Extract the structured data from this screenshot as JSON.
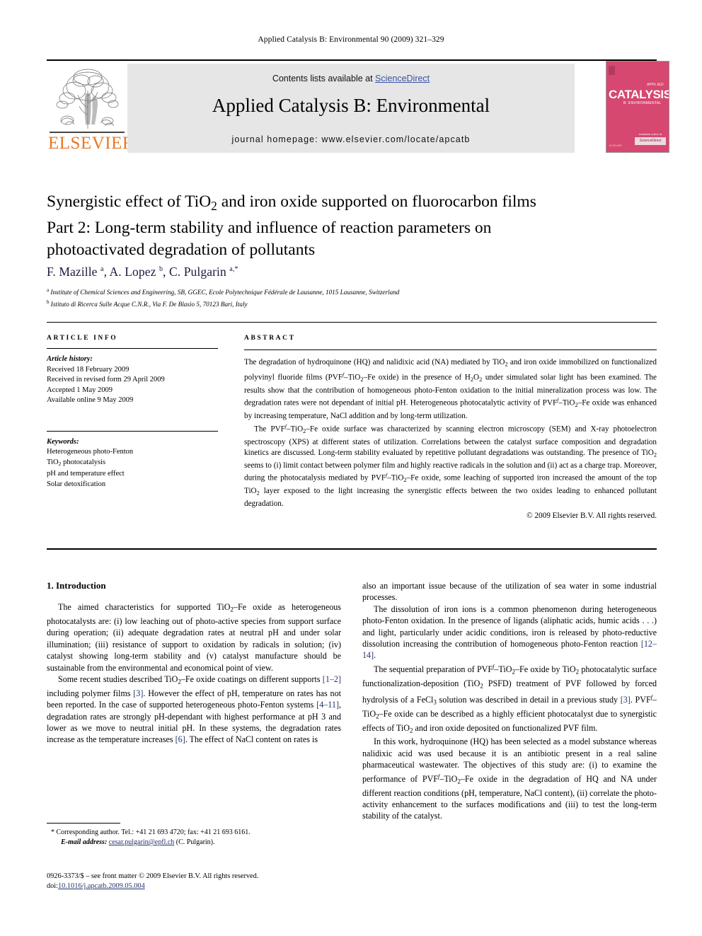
{
  "running_head": "Applied Catalysis B: Environmental 90 (2009) 321–329",
  "masthead": {
    "contents_prefix": "Contents lists available at ",
    "sciencedirect": "ScienceDirect",
    "journal_title": "Applied Catalysis B: Environmental",
    "homepage": "journal homepage: www.elsevier.com/locate/apcatb",
    "publisher": "ELSEVIER",
    "cover": {
      "applied": "APPLIED",
      "catalysis": "CATALYSIS",
      "environmental": "B: ENVIRONMENTAL",
      "sciencedirect_badge": "ScienceDirect",
      "available_online": "Available online at",
      "footline": "ELSEVIER"
    },
    "accent_color": "#E87722",
    "link_color": "#3a53a4",
    "cover_color": "#d6486f"
  },
  "article": {
    "title_line1": "Synergistic effect of TiO2 and iron oxide supported on fluorocarbon films",
    "title_line2": "Part 2: Long-term stability and influence of reaction parameters on",
    "title_line3": "photoactivated degradation of pollutants",
    "authors": "F. Mazille a, A. Lopez b, C. Pulgarin a,*",
    "affiliation_a": "Institute of Chemical Sciences and Engineering, SB, GGEC, Ecole Polytechnique Fédérale de Lausanne, 1015 Lausanne, Switzerland",
    "affiliation_b": "Istituto di Ricerca Sulle Acque C.N.R., Via F. De Blasio 5, 70123 Bari, Italy"
  },
  "article_info": {
    "heading": "ARTICLE INFO",
    "history_label": "Article history:",
    "history": [
      "Received 18 February 2009",
      "Received in revised form 29 April 2009",
      "Accepted 1 May 2009",
      "Available online 9 May 2009"
    ],
    "keywords_label": "Keywords:",
    "keywords": [
      "Heterogeneous photo-Fenton",
      "TiO2 photocatalysis",
      "pH and temperature effect",
      "Solar detoxification"
    ]
  },
  "abstract": {
    "heading": "ABSTRACT",
    "paragraph1": "The degradation of hydroquinone (HQ) and nalidixic acid (NA) mediated by TiO2 and iron oxide immobilized on functionalized polyvinyl fluoride films (PVFf–TiO2–Fe oxide) in the presence of H2O2 under simulated solar light has been examined. The results show that the contribution of homogeneous photo-Fenton oxidation to the initial mineralization process was low. The degradation rates were not dependant of initial pH. Heterogeneous photocatalytic activity of PVFf–TiO2–Fe oxide was enhanced by increasing temperature, NaCl addition and by long-term utilization.",
    "paragraph2": "The PVFf–TiO2–Fe oxide surface was characterized by scanning electron microscopy (SEM) and X-ray photoelectron spectroscopy (XPS) at different states of utilization. Correlations between the catalyst surface composition and degradation kinetics are discussed. Long-term stability evaluated by repetitive pollutant degradations was outstanding. The presence of TiO2 seems to (i) limit contact between polymer film and highly reactive radicals in the solution and (ii) act as a charge trap. Moreover, during the photocatalysis mediated by PVFf–TiO2–Fe oxide, some leaching of supported iron increased the amount of the top TiO2 layer exposed to the light increasing the synergistic effects between the two oxides leading to enhanced pollutant degradation.",
    "copyright": "© 2009 Elsevier B.V. All rights reserved."
  },
  "body": {
    "section1_heading": "1. Introduction",
    "left_p1": "The aimed characteristics for supported TiO2–Fe oxide as heterogeneous photocatalysts are: (i) low leaching out of photo-active species from support surface during operation; (ii) adequate degradation rates at neutral pH and under solar illumination; (iii) resistance of support to oxidation by radicals in solution; (iv) catalyst showing long-term stability and (v) catalyst manufacture should be sustainable from the environmental and economical point of view.",
    "left_p2": "Some recent studies described TiO2–Fe oxide coatings on different supports [1–2] including polymer films [3]. However the effect of pH, temperature on rates has not been reported. In the case of supported heterogeneous photo-Fenton systems [4–11], degradation rates are strongly pH-dependant with highest performance at pH 3 and lower as we move to neutral initial pH. In these systems, the degradation rates increase as the temperature increases [6]. The effect of NaCl content on rates is",
    "right_p1": "also an important issue because of the utilization of sea water in some industrial processes.",
    "right_p2": "The dissolution of iron ions is a common phenomenon during heterogeneous photo-Fenton oxidation. In the presence of ligands (aliphatic acids, humic acids . . .) and light, particularly under acidic conditions, iron is released by photo-reductive dissolution increasing the contribution of homogeneous photo-Fenton reaction [12–14].",
    "right_p3": "The sequential preparation of PVFf–TiO2–Fe oxide by TiO2 photocatalytic surface functionalization-deposition (TiO2 PSFD) treatment of PVF followed by forced hydrolysis of a FeCl3 solution was described in detail in a previous study [3]. PVFf–TiO2–Fe oxide can be described as a highly efficient photocatalyst due to synergistic effects of TiO2 and iron oxide deposited on functionalized PVF film.",
    "right_p4": "In this work, hydroquinone (HQ) has been selected as a model substance whereas nalidixic acid was used because it is an antibiotic present in a real saline pharmaceutical wastewater. The objectives of this study are: (i) to examine the performance of PVFf–TiO2–Fe oxide in the degradation of HQ and NA under different reaction conditions (pH, temperature, NaCl content), (ii) correlate the photo-activity enhancement to the surfaces modifications and (iii) to test the long-term stability of the catalyst."
  },
  "footnotes": {
    "corresponding": "* Corresponding author. Tel.: +41 21 693 4720; fax: +41 21 693 6161.",
    "email_label": "E-mail address:",
    "email": "cesar.pulgarin@epfl.ch",
    "email_suffix": "(C. Pulgarin).",
    "imprint_line1": "0926-3373/$ – see front matter © 2009 Elsevier B.V. All rights reserved.",
    "doi_label": "doi:",
    "doi": "10.1016/j.apcatb.2009.05.004"
  }
}
